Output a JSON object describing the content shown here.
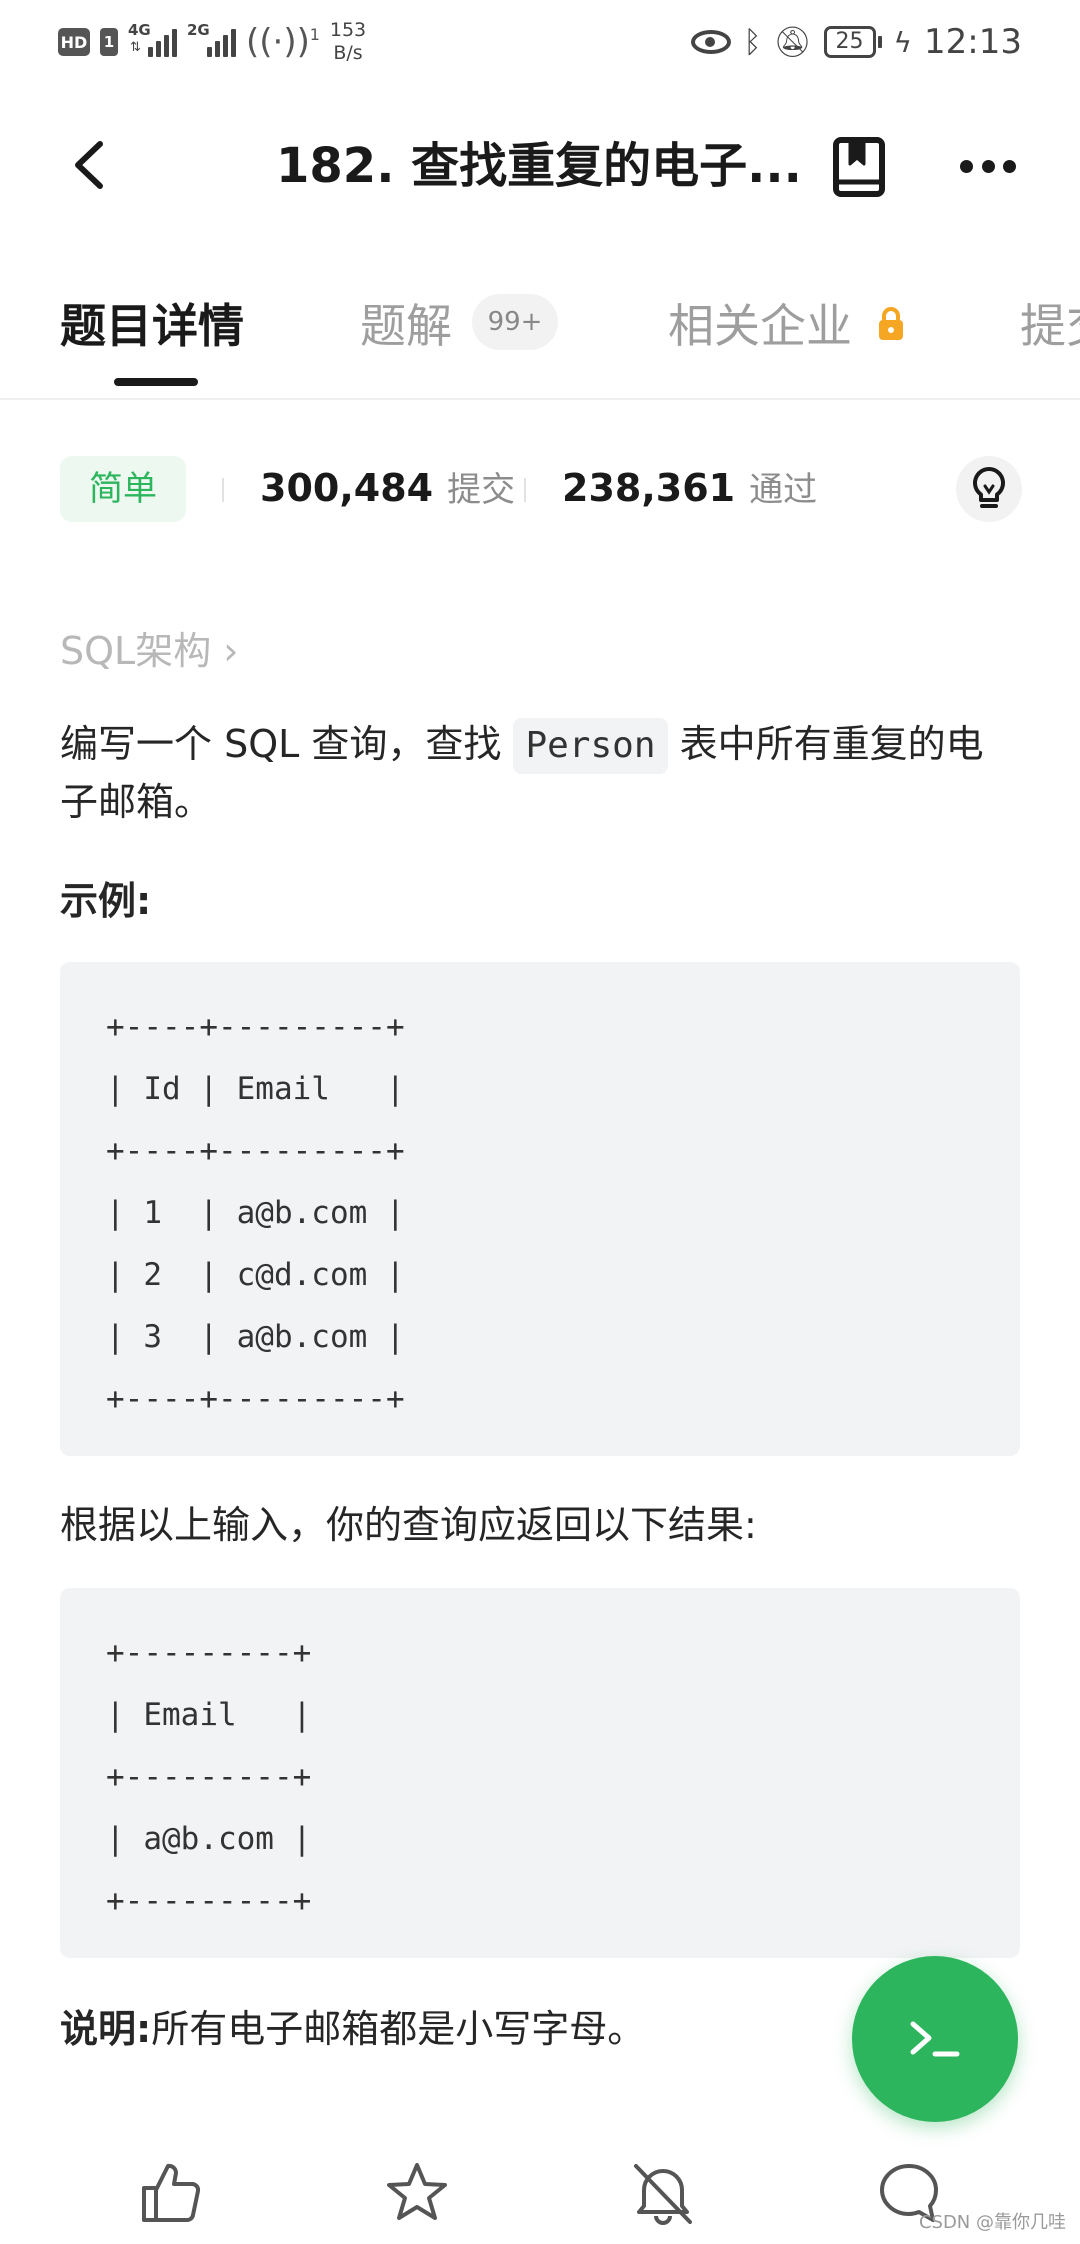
{
  "status_bar": {
    "hd": "HD",
    "sim": "1",
    "sig1_tag": "4G",
    "sig2_tag": "2G",
    "hotspot_sup": "1",
    "net_speed_value": "153",
    "net_speed_unit": "B/s",
    "battery_level": "25",
    "time": "12:13"
  },
  "header": {
    "title": "182. 查找重复的电子..."
  },
  "tabs": [
    {
      "label": "题目详情"
    },
    {
      "label": "题解"
    },
    {
      "label": "相关企业"
    },
    {
      "label": "提交"
    }
  ],
  "solutions_badge": "99+",
  "stats": {
    "difficulty": "简单",
    "submissions_count": "300,484",
    "submissions_label": "提交",
    "accepted_count": "238,361",
    "accepted_label": "通过"
  },
  "breadcrumb": "SQL架构 ›",
  "description": {
    "before": "编写一个 SQL 查询，查找 ",
    "code": "Person",
    "after": " 表中所有重复的电子邮箱。"
  },
  "example_label": "示例:",
  "input_table": [
    "+----+---------+",
    "| Id | Email   |",
    "+----+---------+",
    "| 1  | a@b.com |",
    "| 2  | c@d.com |",
    "| 3  | a@b.com |",
    "+----+---------+"
  ],
  "result_intro": "根据以上输入，你的查询应返回以下结果:",
  "output_table": [
    "+---------+",
    "| Email   |",
    "+---------+",
    "| a@b.com |",
    "+---------+"
  ],
  "note": {
    "label": "说明:",
    "text": "所有电子邮箱都是小写字母。"
  },
  "watermark": "CSDN @靠你几哇",
  "colors": {
    "accent_green": "#2db55d",
    "lock_orange": "#f5a623"
  }
}
